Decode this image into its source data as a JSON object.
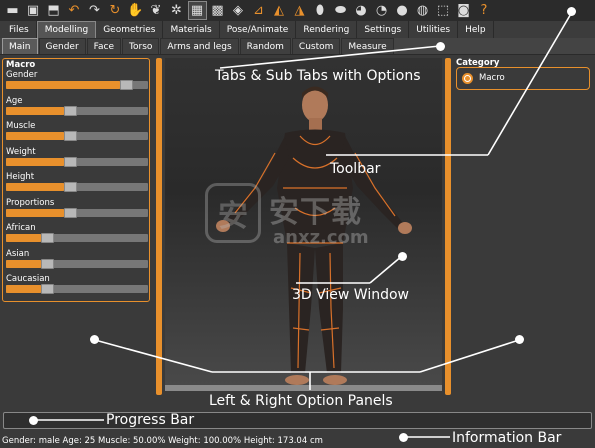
{
  "toolbar": {
    "icons": [
      "folder-icon",
      "save-icon",
      "export-icon",
      "undo-icon",
      "redo-icon",
      "reset-icon",
      "pose-icon",
      "smooth-icon",
      "wireframe-icon",
      "background-icon",
      "grid-icon",
      "symmetry-right-icon",
      "symmetry-left-icon",
      "symmetry-icon",
      "front-view-icon",
      "back-view-icon",
      "left-view-icon",
      "right-view-icon",
      "top-view-icon",
      "bottom-view-icon",
      "reset-camera-icon",
      "screenshot-icon",
      "help-icon"
    ]
  },
  "main_tabs": [
    {
      "label": "Files",
      "active": false
    },
    {
      "label": "Modelling",
      "active": true
    },
    {
      "label": "Geometries",
      "active": false
    },
    {
      "label": "Materials",
      "active": false
    },
    {
      "label": "Pose/Animate",
      "active": false
    },
    {
      "label": "Rendering",
      "active": false
    },
    {
      "label": "Settings",
      "active": false
    },
    {
      "label": "Utilities",
      "active": false
    },
    {
      "label": "Help",
      "active": false
    }
  ],
  "sub_tabs": [
    {
      "label": "Main",
      "active": true
    },
    {
      "label": "Gender",
      "active": false
    },
    {
      "label": "Face",
      "active": false
    },
    {
      "label": "Torso",
      "active": false
    },
    {
      "label": "Arms and legs",
      "active": false
    },
    {
      "label": "Random",
      "active": false
    },
    {
      "label": "Custom",
      "active": false
    },
    {
      "label": "Measure",
      "active": false
    }
  ],
  "left_panel": {
    "title": "Macro",
    "sliders": [
      {
        "label": "Gender",
        "value": 0.88
      },
      {
        "label": "Age",
        "value": 0.45
      },
      {
        "label": "Muscle",
        "value": 0.45
      },
      {
        "label": "Weight",
        "value": 0.45
      },
      {
        "label": "Height",
        "value": 0.45
      },
      {
        "label": "Proportions",
        "value": 0.45
      },
      {
        "label": "African",
        "value": 0.27
      },
      {
        "label": "Asian",
        "value": 0.27
      },
      {
        "label": "Caucasian",
        "value": 0.27
      }
    ]
  },
  "right_panel": {
    "title": "Category",
    "option": "Macro"
  },
  "status_text": "Gender: male Age: 25 Muscle: 50.00% Weight: 100.00% Height: 173.04 cm",
  "annotations": {
    "tabs": "Tabs & Sub Tabs with Options",
    "toolbar": "Toolbar",
    "view": "3D View Window",
    "panels": "Left & Right Option Panels",
    "progress": "Progress Bar",
    "info": "Information Bar"
  },
  "watermark": {
    "main": "安下载",
    "sub": "anxz.com",
    "logo": "安"
  },
  "colors": {
    "accent": "#e8902c",
    "background": "#3a3a3a",
    "toolbar": "#2b2b2b"
  }
}
